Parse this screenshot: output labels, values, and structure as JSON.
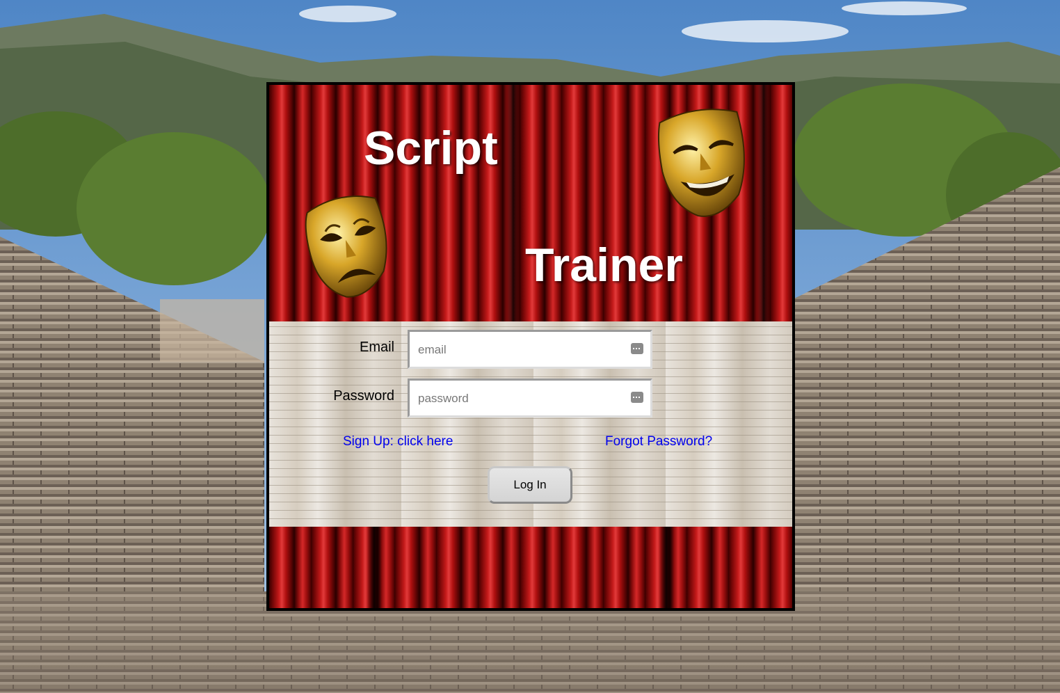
{
  "title": {
    "line1": "Script",
    "line2": "Trainer"
  },
  "form": {
    "email_label": "Email",
    "email_placeholder": "email",
    "password_label": "Password",
    "password_placeholder": "password",
    "signup_link": "Sign Up: click here",
    "forgot_link": "Forgot Password?",
    "login_button": "Log In"
  },
  "icons": {
    "tragedy_mask": "tragedy-mask-icon",
    "comedy_mask": "comedy-mask-icon",
    "field_key": "password-manager-key-icon"
  },
  "colors": {
    "curtain": "#b01010",
    "link": "#0000ee",
    "title_text": "#ffffff",
    "panel_border": "#000000"
  }
}
